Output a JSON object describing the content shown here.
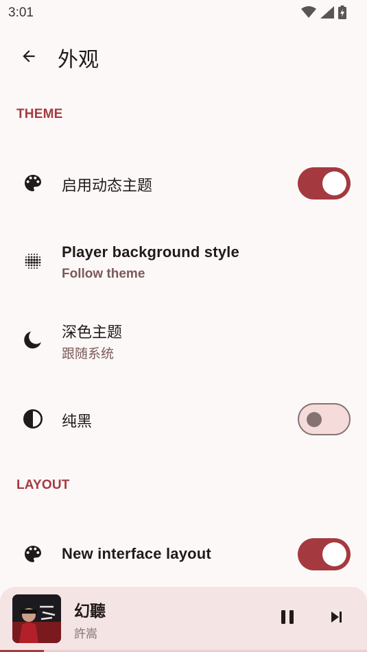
{
  "status_bar": {
    "time": "3:01",
    "icons": [
      "wifi-icon",
      "signal-icon",
      "battery-charging-icon"
    ]
  },
  "app_bar": {
    "back_icon": "arrow-back-icon",
    "title": "外观"
  },
  "sections": {
    "theme": {
      "header": "THEME",
      "items": {
        "dynamic_theme": {
          "icon": "palette-icon",
          "title": "启用动态主题",
          "switch_on": true
        },
        "player_bg": {
          "icon": "gradient-dots-icon",
          "title": "Player background style",
          "subtitle": "Follow theme"
        },
        "dark_theme": {
          "icon": "moon-icon",
          "title": "深色主题",
          "subtitle": "跟随系统"
        },
        "pure_black": {
          "icon": "contrast-icon",
          "title": "纯黑",
          "switch_on": false
        }
      }
    },
    "layout": {
      "header": "LAYOUT",
      "items": {
        "new_layout": {
          "icon": "palette-icon",
          "title": "New interface layout",
          "switch_on": true
        }
      }
    }
  },
  "mini_player": {
    "title": "幻聽",
    "artist": "許嵩",
    "progress": 0.12,
    "pause_icon": "pause-icon",
    "next_icon": "skip-next-icon"
  },
  "colors": {
    "accent": "#a43a3f",
    "background": "#fdf8f8",
    "mini_player_bg": "#f5e4e4"
  }
}
